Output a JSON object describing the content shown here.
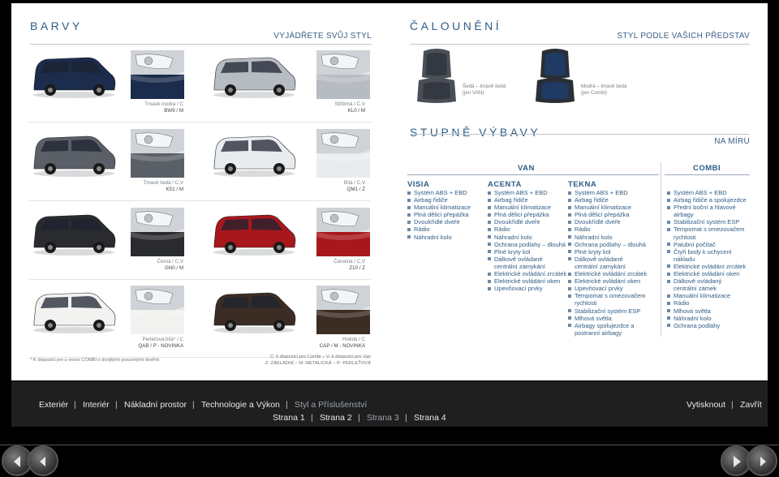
{
  "colors_section": {
    "title": "BARVY",
    "subtitle": "VYJÁDŘETE SVŮJ STYL",
    "cars": [
      {
        "name": "Tmavě modrá / C",
        "code": "BW9 / M",
        "color": "#1b2c4d"
      },
      {
        "name": "Stříbrná / C,V",
        "code": "KL0 / M",
        "color": "#b7bcc2"
      },
      {
        "name": "Tmavě šedá / C,V",
        "code": "K51 / M",
        "color": "#5b6068"
      },
      {
        "name": "Bílá / C,V",
        "code": "QM1 / Z",
        "color": "#e9ecef"
      },
      {
        "name": "Černá / C,V",
        "code": "GN0 / M",
        "color": "#2a2b2e"
      },
      {
        "name": "Červená / C,V",
        "code": "Z10 / Z",
        "color": "#a8171c"
      },
      {
        "name": "Perleťová bílá* / C",
        "code": "QAB / P - NOVINKA",
        "color": "#f2f3f1"
      },
      {
        "name": "Hnědá / C",
        "code": "CAP / M - NOVINKA",
        "color": "#3b2c24"
      }
    ],
    "footnote": "* K dispozici jen u verze COMBI s dvojitými posuvnými dveřmi",
    "legend_line1": "C: k dispozici pro Combi – V: k dispozici pro Van",
    "legend_line2": "Z: ZÁKLADNÍ – M: METALICKÁ – P: PERLEŤOVÁ"
  },
  "upholstery_section": {
    "title": "ČALOUNĚNÍ",
    "subtitle": "STYL PODLE VAŠICH PŘEDSTAV",
    "seats": [
      {
        "line1": "Šedá – tmavě šedá",
        "line2": "(jen VAN)",
        "color": "#3d4148"
      },
      {
        "line1": "Modrá – tmavě šedá",
        "line2": "(jen Combi)",
        "color": "#1f3558"
      }
    ]
  },
  "trim_section": {
    "title": "STUPNĚ VÝBAVY",
    "subtitle": "NA MÍRU",
    "group_van": "VAN",
    "group_combi": "COMBI",
    "columns": [
      {
        "name": "VISIA",
        "features": [
          "Systém ABS + EBD",
          "Airbag řidiče",
          "Manuální klimatizace",
          "Plná dělicí přepážka",
          "Dvoukřídlé dveře",
          "Rádio",
          "Náhradní kolo"
        ]
      },
      {
        "name": "ACENTA",
        "features": [
          "Systém ABS + EBD",
          "Airbag řidiče",
          "Manuální klimatizace",
          "Plná dělicí přepážka",
          "Dvoukřídlé dveře",
          "Rádio",
          "Náhradní kolo",
          "Ochrana podlahy – dlouhá",
          "Plné kryty kol",
          "Dálkově ovládané centrální zamykání",
          "Elektrické ovládání zrcátek",
          "Elektrické ovládání oken",
          "Upevňovací prvky"
        ]
      },
      {
        "name": "TEKNA",
        "features": [
          "Systém ABS + EBD",
          "Airbag řidiče",
          "Manuální klimatizace",
          "Plná dělicí přepážka",
          "Dvoukřídlé dveře",
          "Rádio",
          "Náhradní kolo",
          "Ochrana podlahy – dlouhá",
          "Plné kryty kol",
          "Dálkově ovládané centrální zamykání",
          "Elektrické ovládání zrcátek",
          "Elektrické ovládání oken",
          "Upevňovací prvky",
          "Tempomat s omezovačem rychlosti",
          "Stabilizační systém ESP",
          "Mlhová světla",
          "Airbagy spolujezdce a postranní airbagy"
        ]
      },
      {
        "name": "",
        "features": [
          "Systém ABS + EBD",
          "Airbag řidiče a spolujezdce",
          "Přední boční a hlavové airbagy",
          "Stabilizační systém ESP",
          "Tempomat s omezovačem rychlosti",
          "Palubní počítač",
          "Čtyři body k uchycení nákladu",
          "Elektrické ovládání zrcátek",
          "Elektrické ovládání oken",
          "Dálkově ovládaný centrální zámek",
          "Manuální klimatizace",
          "Rádio",
          "Mlhová světla",
          "Náhradní kolo",
          "Ochrana podlahy"
        ]
      }
    ]
  },
  "nav": {
    "main_links": [
      "Exteriér",
      "Interiér",
      "Nákladní prostor",
      "Technologie a Výkon",
      "Styl a Příslušenství"
    ],
    "active_main": 4,
    "page_links": [
      "Strana 1",
      "Strana 2",
      "Strana 3",
      "Strana 4"
    ],
    "active_page": 2,
    "right_links": [
      "Vytisknout",
      "Zavřít"
    ],
    "separator": "|"
  },
  "accent_color": "#2f5d86"
}
